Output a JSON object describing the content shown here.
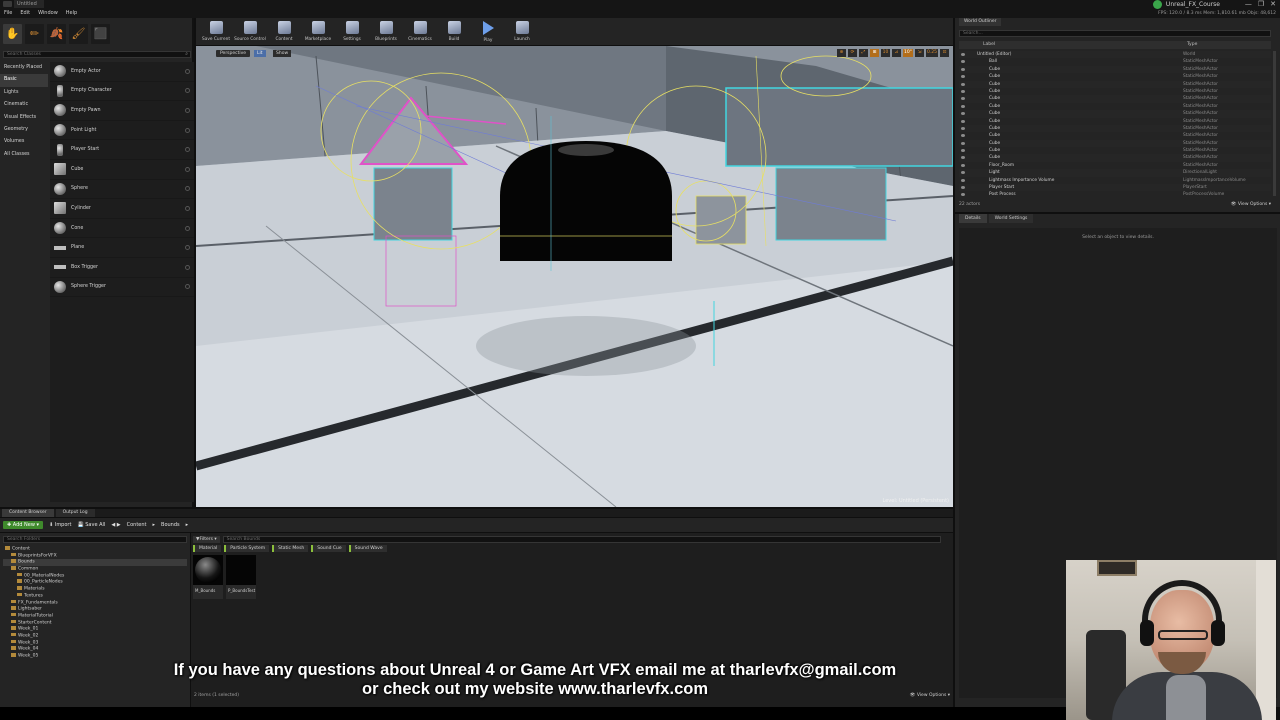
{
  "titlebar": {
    "doc_tab": "Untitled",
    "menu": [
      "File",
      "Edit",
      "Window",
      "Help"
    ],
    "project_name": "Unreal_FX_Course",
    "perf_readout": "FPS: 120.0 / 8.3 ms   Mem: 1,810.61 mb   Objs: 48,612",
    "window_controls": [
      "—",
      "❐",
      "✕"
    ]
  },
  "modes": {
    "tab_icons": [
      "✋",
      "✏",
      "🍂",
      "🖌",
      "⬛"
    ],
    "search_placeholder": "Search Classes",
    "categories": [
      "Recently Placed",
      "Basic",
      "Lights",
      "Cinematic",
      "Visual Effects",
      "Geometry",
      "Volumes",
      "All Classes"
    ],
    "active_category": 1,
    "items": [
      {
        "label": "Empty Actor",
        "thumb": "sphere"
      },
      {
        "label": "Empty Character",
        "thumb": "figure"
      },
      {
        "label": "Empty Pawn",
        "thumb": "sphere"
      },
      {
        "label": "Point Light",
        "thumb": "sphere"
      },
      {
        "label": "Player Start",
        "thumb": "figure"
      },
      {
        "label": "Cube",
        "thumb": "cube"
      },
      {
        "label": "Sphere",
        "thumb": "sphere"
      },
      {
        "label": "Cylinder",
        "thumb": "cube"
      },
      {
        "label": "Cone",
        "thumb": "sphere"
      },
      {
        "label": "Plane",
        "thumb": "plane"
      },
      {
        "label": "Box Trigger",
        "thumb": "plane"
      },
      {
        "label": "Sphere Trigger",
        "thumb": "sphere"
      }
    ]
  },
  "toolbar": {
    "buttons": [
      {
        "label": "Save Current",
        "icon": "save-icon"
      },
      {
        "label": "Source Control",
        "icon": "source-control-icon"
      },
      {
        "label": "Content",
        "icon": "content-icon"
      },
      {
        "label": "Marketplace",
        "icon": "marketplace-icon"
      },
      {
        "label": "Settings",
        "icon": "settings-icon"
      },
      {
        "label": "Blueprints",
        "icon": "blueprints-icon"
      },
      {
        "label": "Cinematics",
        "icon": "cinematics-icon"
      },
      {
        "label": "Build",
        "icon": "build-icon"
      },
      {
        "label": "Play",
        "icon": "play-icon"
      },
      {
        "label": "Launch",
        "icon": "launch-icon"
      }
    ]
  },
  "viewport": {
    "perspective_label": "Perspective",
    "lit_label": "Lit",
    "show_label": "Show",
    "snap_tools": [
      "⊕",
      "⟳",
      "⤢",
      "⊞",
      "10",
      "⊿",
      "10°",
      "⇲",
      "0.25",
      "⊡"
    ],
    "level_label": "Level:  Untitled (Persistent)"
  },
  "outliner": {
    "tab": "World Outliner",
    "search_placeholder": "Search...",
    "col_label": "Label",
    "col_type": "Type",
    "rows": [
      {
        "label": "Untitled (Editor)",
        "type": "World"
      },
      {
        "label": "Ball",
        "type": "StaticMeshActor"
      },
      {
        "label": "Cube",
        "type": "StaticMeshActor"
      },
      {
        "label": "Cube",
        "type": "StaticMeshActor"
      },
      {
        "label": "Cube",
        "type": "StaticMeshActor"
      },
      {
        "label": "Cube",
        "type": "StaticMeshActor"
      },
      {
        "label": "Cube",
        "type": "StaticMeshActor"
      },
      {
        "label": "Cube",
        "type": "StaticMeshActor"
      },
      {
        "label": "Cube",
        "type": "StaticMeshActor"
      },
      {
        "label": "Cube",
        "type": "StaticMeshActor"
      },
      {
        "label": "Cube",
        "type": "StaticMeshActor"
      },
      {
        "label": "Cube",
        "type": "StaticMeshActor"
      },
      {
        "label": "Cube",
        "type": "StaticMeshActor"
      },
      {
        "label": "Cube",
        "type": "StaticMeshActor"
      },
      {
        "label": "Cube",
        "type": "StaticMeshActor"
      },
      {
        "label": "Floor_Room",
        "type": "StaticMeshActor"
      },
      {
        "label": "Light",
        "type": "DirectionalLight"
      },
      {
        "label": "Lightmass Importance Volume",
        "type": "LightmassImportanceVolume"
      },
      {
        "label": "Player Start",
        "type": "PlayerStart"
      },
      {
        "label": "Post Process",
        "type": "PostProcessVolume"
      }
    ],
    "actor_count": "22 actors",
    "view_options": "👁 View Options ▾"
  },
  "details": {
    "tabs": [
      "Details",
      "World Settings"
    ],
    "empty_text": "Select an object to view details."
  },
  "content_browser": {
    "tabs": [
      "Content Browser",
      "Output Log"
    ],
    "add_new": "✚ Add New ▾",
    "import": "⬇ Import",
    "save_all": "💾 Save All",
    "nav": "◀ ▶",
    "path": [
      "Content",
      "▸",
      "Bounds",
      "▸"
    ],
    "folder_search_placeholder": "Search Folders",
    "folders": [
      {
        "label": "Content",
        "indent": 0,
        "selected": false
      },
      {
        "label": "BlueprintsForVFX",
        "indent": 1,
        "selected": false
      },
      {
        "label": "Bounds",
        "indent": 1,
        "selected": true
      },
      {
        "label": "Common",
        "indent": 1,
        "selected": false
      },
      {
        "label": "00_MaterialNodes",
        "indent": 2,
        "selected": false
      },
      {
        "label": "00_ParticleNodes",
        "indent": 2,
        "selected": false
      },
      {
        "label": "Materials",
        "indent": 2,
        "selected": false
      },
      {
        "label": "Textures",
        "indent": 2,
        "selected": false
      },
      {
        "label": "FX_Fundamentals",
        "indent": 1,
        "selected": false
      },
      {
        "label": "Lightsaber",
        "indent": 1,
        "selected": false
      },
      {
        "label": "MaterialTutorial",
        "indent": 1,
        "selected": false
      },
      {
        "label": "StarterContent",
        "indent": 1,
        "selected": false
      },
      {
        "label": "Week_01",
        "indent": 1,
        "selected": false
      },
      {
        "label": "Week_02",
        "indent": 1,
        "selected": false
      },
      {
        "label": "Week_03",
        "indent": 1,
        "selected": false
      },
      {
        "label": "Week_04",
        "indent": 1,
        "selected": false
      },
      {
        "label": "Week_05",
        "indent": 1,
        "selected": false
      }
    ],
    "filters_label": "▼Filters ▾",
    "asset_search_placeholder": "Search Bounds",
    "type_filters": [
      "Material",
      "Particle System",
      "Static Mesh",
      "Sound Cue",
      "Sound Wave"
    ],
    "assets": [
      {
        "name": "M_Bounds",
        "kind": "material"
      },
      {
        "name": "P_BoundsTest",
        "kind": "particle"
      }
    ],
    "status": "2 items (1 selected)",
    "view_options": "👁 View Options ▾"
  },
  "caption": {
    "line1": "If you have any questions about Unreal 4 or Game Art VFX email me at tharlevfx@gmail.com",
    "line2": "or check out my website www.tharlevfx.com"
  }
}
